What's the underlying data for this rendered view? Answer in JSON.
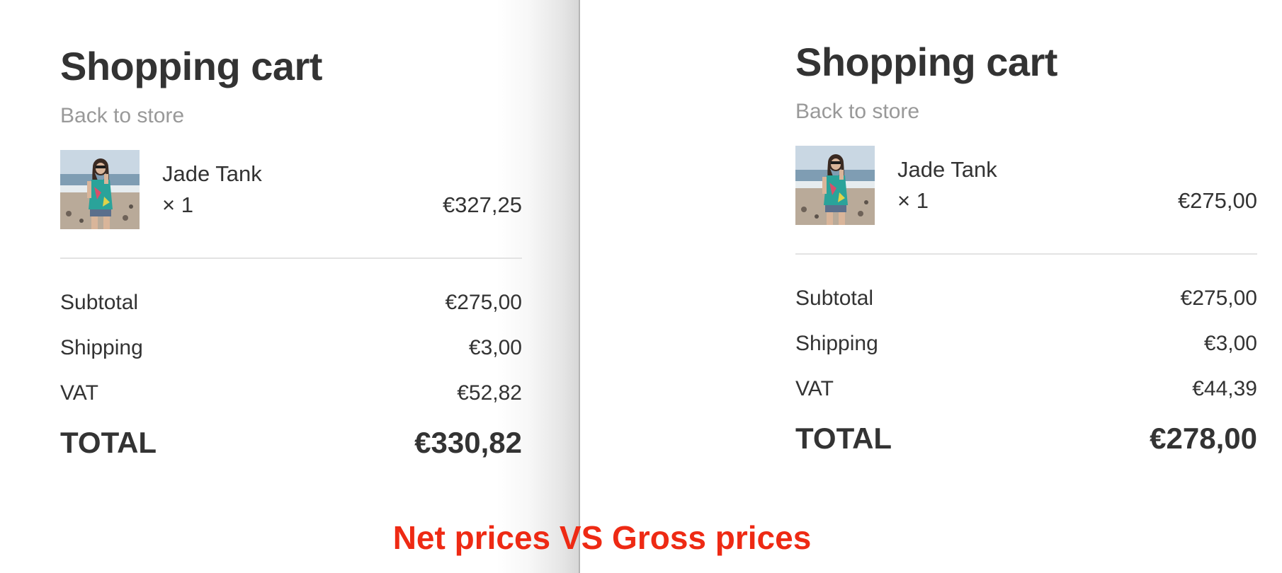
{
  "caption": "Net prices VS Gross prices",
  "colors": {
    "caption": "#ee2a14",
    "text": "#333333",
    "muted": "#999999",
    "divider": "#e3e3e3"
  },
  "panels": [
    {
      "title": "Shopping cart",
      "back_link": "Back to store",
      "item": {
        "image": "product-photo-woman-beach",
        "name": "Jade Tank",
        "quantity": "× 1",
        "price": "€327,25"
      },
      "summary": {
        "subtotal_label": "Subtotal",
        "subtotal_value": "€275,00",
        "shipping_label": "Shipping",
        "shipping_value": "€3,00",
        "vat_label": "VAT",
        "vat_value": "€52,82",
        "total_label": "TOTAL",
        "total_value": "€330,82"
      }
    },
    {
      "title": "Shopping cart",
      "back_link": "Back to store",
      "item": {
        "image": "product-photo-woman-beach",
        "name": "Jade Tank",
        "quantity": "× 1",
        "price": "€275,00"
      },
      "summary": {
        "subtotal_label": "Subtotal",
        "subtotal_value": "€275,00",
        "shipping_label": "Shipping",
        "shipping_value": "€3,00",
        "vat_label": "VAT",
        "vat_value": "€44,39",
        "total_label": "TOTAL",
        "total_value": "€278,00"
      }
    }
  ]
}
